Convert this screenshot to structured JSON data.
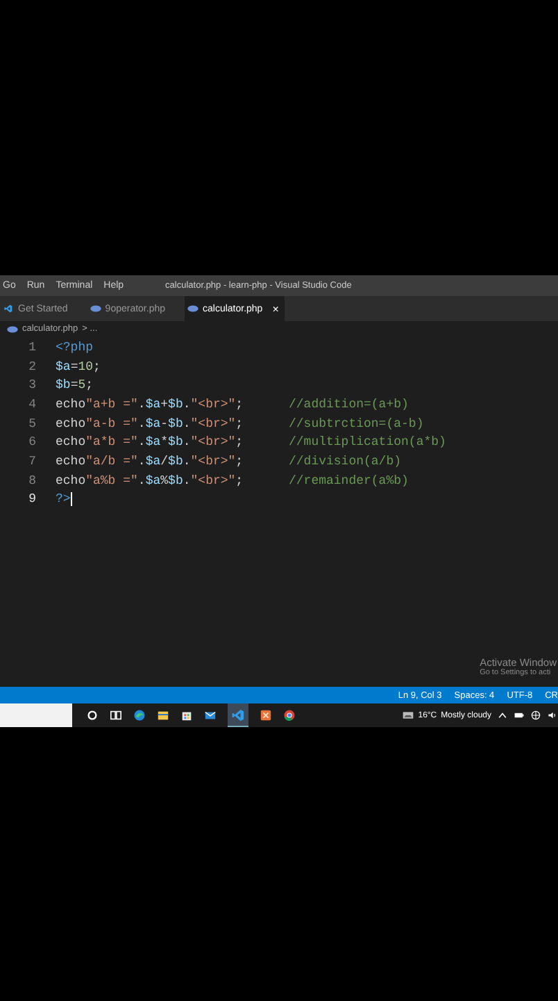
{
  "menu": [
    "Go",
    "Run",
    "Terminal",
    "Help"
  ],
  "window": {
    "title": "calculator.php - learn-php - Visual Studio Code"
  },
  "tabs": [
    {
      "label": "Get Started",
      "kind": "welcome",
      "selected": false
    },
    {
      "label": "9operator.php",
      "kind": "php",
      "selected": false
    },
    {
      "label": "calculator.php",
      "kind": "php",
      "selected": true,
      "close": "×"
    }
  ],
  "breadcrumb": {
    "file": "calculator.php",
    "rest": "> ..."
  },
  "lines": [
    {
      "number": "1",
      "current": false,
      "tokens": [
        {
          "kind": "tag",
          "text": "<?php"
        }
      ]
    },
    {
      "number": "2",
      "current": false,
      "tokens": [
        {
          "kind": "var",
          "text": "$a"
        },
        {
          "kind": "plain",
          "text": "="
        },
        {
          "kind": "num",
          "text": "10"
        },
        {
          "kind": "plain",
          "text": ";"
        }
      ]
    },
    {
      "number": "3",
      "current": false,
      "tokens": [
        {
          "kind": "var",
          "text": "$b"
        },
        {
          "kind": "plain",
          "text": "="
        },
        {
          "kind": "num",
          "text": "5"
        },
        {
          "kind": "plain",
          "text": ";"
        }
      ]
    },
    {
      "number": "4",
      "current": false,
      "tokens": [
        {
          "kind": "plain",
          "text": "echo"
        },
        {
          "kind": "str",
          "text": "\"a+b =\""
        },
        {
          "kind": "plain",
          "text": "."
        },
        {
          "kind": "var",
          "text": "$a"
        },
        {
          "kind": "plain",
          "text": "+"
        },
        {
          "kind": "var",
          "text": "$b"
        },
        {
          "kind": "plain",
          "text": "."
        },
        {
          "kind": "str",
          "text": "\"<br>\""
        },
        {
          "kind": "plain",
          "text": ";"
        }
      ],
      "comment": "//addition=(a+b)"
    },
    {
      "number": "5",
      "current": false,
      "tokens": [
        {
          "kind": "plain",
          "text": "echo"
        },
        {
          "kind": "str",
          "text": "\"a-b =\""
        },
        {
          "kind": "plain",
          "text": "."
        },
        {
          "kind": "var",
          "text": "$a"
        },
        {
          "kind": "plain",
          "text": "-"
        },
        {
          "kind": "var",
          "text": "$b"
        },
        {
          "kind": "plain",
          "text": "."
        },
        {
          "kind": "str",
          "text": "\"<br>\""
        },
        {
          "kind": "plain",
          "text": ";"
        }
      ],
      "comment": "//subtrction=(a-b)"
    },
    {
      "number": "6",
      "current": false,
      "tokens": [
        {
          "kind": "plain",
          "text": "echo"
        },
        {
          "kind": "str",
          "text": "\"a*b =\""
        },
        {
          "kind": "plain",
          "text": "."
        },
        {
          "kind": "var",
          "text": "$a"
        },
        {
          "kind": "plain",
          "text": "*"
        },
        {
          "kind": "var",
          "text": "$b"
        },
        {
          "kind": "plain",
          "text": "."
        },
        {
          "kind": "str",
          "text": "\"<br>\""
        },
        {
          "kind": "plain",
          "text": ";"
        }
      ],
      "comment": "//multiplication(a*b)"
    },
    {
      "number": "7",
      "current": false,
      "tokens": [
        {
          "kind": "plain",
          "text": "echo"
        },
        {
          "kind": "str",
          "text": "\"a/b =\""
        },
        {
          "kind": "plain",
          "text": "."
        },
        {
          "kind": "var",
          "text": "$a"
        },
        {
          "kind": "plain",
          "text": "/"
        },
        {
          "kind": "var",
          "text": "$b"
        },
        {
          "kind": "plain",
          "text": "."
        },
        {
          "kind": "str",
          "text": "\"<br>\""
        },
        {
          "kind": "plain",
          "text": ";"
        }
      ],
      "comment": "//division(a/b)"
    },
    {
      "number": "8",
      "current": false,
      "tokens": [
        {
          "kind": "plain",
          "text": "echo"
        },
        {
          "kind": "str",
          "text": "\"a%b =\""
        },
        {
          "kind": "plain",
          "text": "."
        },
        {
          "kind": "var",
          "text": "$a"
        },
        {
          "kind": "plain",
          "text": "%"
        },
        {
          "kind": "var",
          "text": "$b"
        },
        {
          "kind": "plain",
          "text": "."
        },
        {
          "kind": "str",
          "text": "\"<br>\""
        },
        {
          "kind": "plain",
          "text": ";"
        }
      ],
      "comment": "//remainder(a%b)"
    },
    {
      "number": "9",
      "current": true,
      "tokens": [
        {
          "kind": "tag",
          "text": "?>"
        }
      ]
    }
  ],
  "activation": {
    "title": "Activate Window",
    "subtitle": "Go to Settings to acti"
  },
  "status_bar": [
    "Ln 9, Col 3",
    "Spaces: 4",
    "UTF-8",
    "CR"
  ],
  "taskbar": {
    "weather": "16°C",
    "forecast": "Mostly cloudy"
  }
}
